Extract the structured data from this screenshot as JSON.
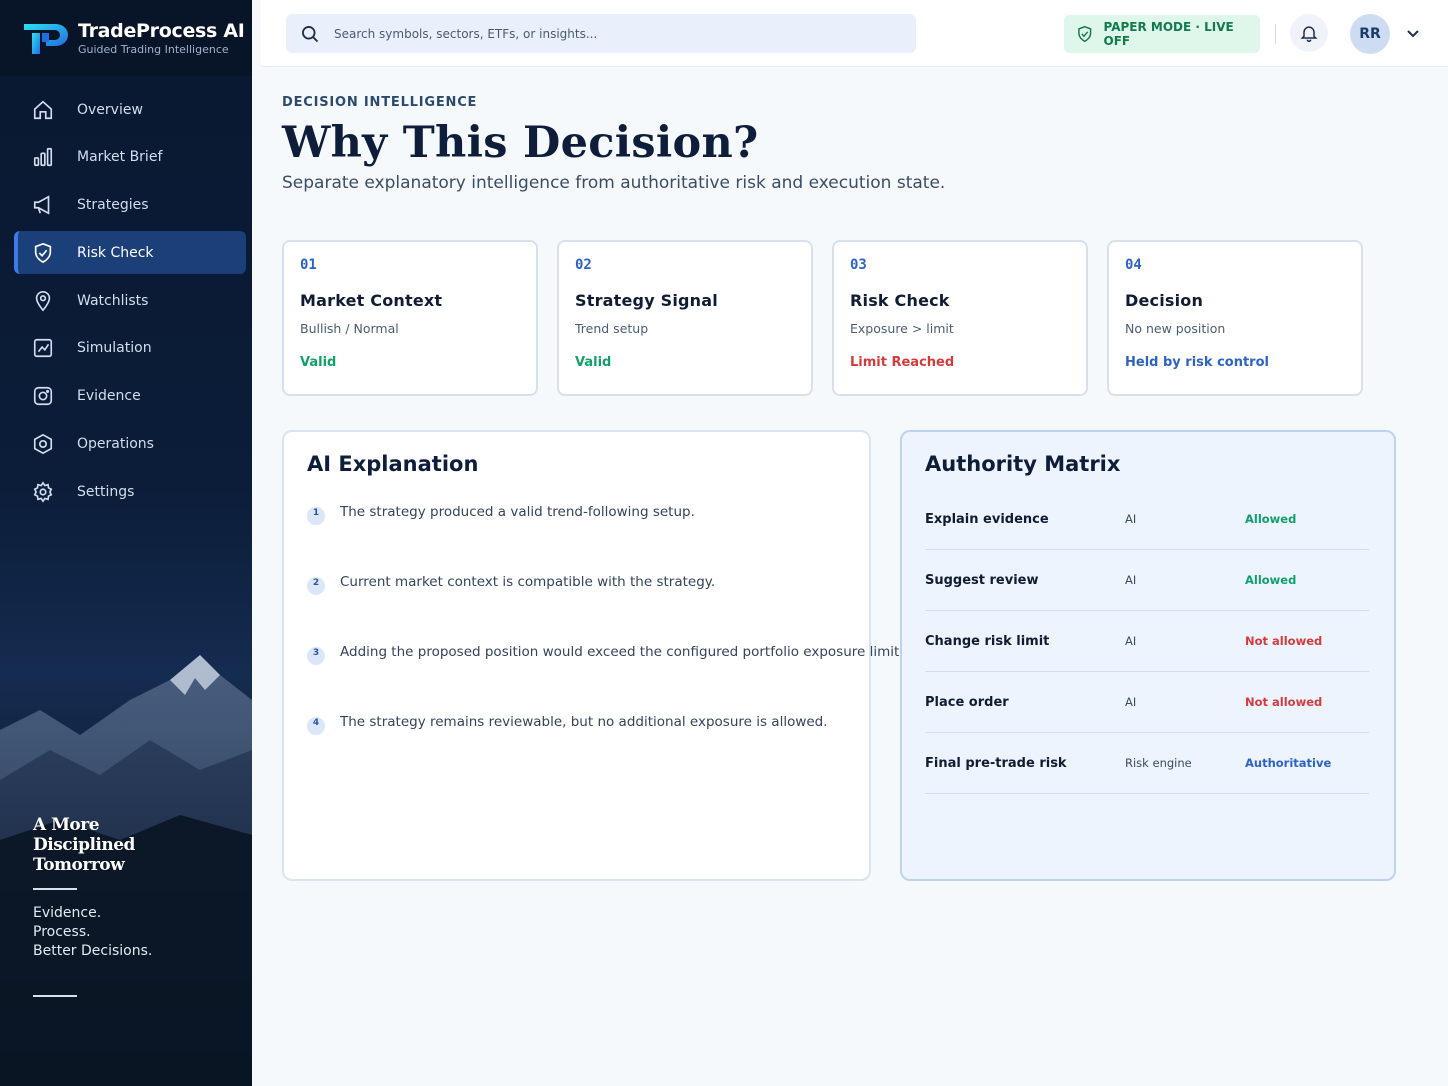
{
  "brand": {
    "name": "TradeProcess AI",
    "tagline": "Guided Trading Intelligence"
  },
  "sidebar": {
    "items": [
      {
        "label": "Overview",
        "icon": "home-icon"
      },
      {
        "label": "Market Brief",
        "icon": "bar-chart-icon"
      },
      {
        "label": "Strategies",
        "icon": "megaphone-icon"
      },
      {
        "label": "Risk Check",
        "icon": "shield-icon",
        "active": true
      },
      {
        "label": "Watchlists",
        "icon": "location-pin-icon"
      },
      {
        "label": "Simulation",
        "icon": "chart-square-icon"
      },
      {
        "label": "Evidence",
        "icon": "camera-icon"
      },
      {
        "label": "Operations",
        "icon": "hexagon-gear-icon"
      },
      {
        "label": "Settings",
        "icon": "gear-icon"
      }
    ],
    "promo": {
      "title_lines": [
        "A More",
        "Disciplined",
        "Tomorrow"
      ],
      "motto_lines": [
        "Evidence.",
        "Process.",
        "Better Decisions."
      ]
    }
  },
  "topbar": {
    "search_placeholder": "Search symbols, sectors, ETFs, or insights...",
    "mode_badge": "PAPER MODE · LIVE OFF",
    "avatar_initials": "RR"
  },
  "header": {
    "eyebrow": "DECISION INTELLIGENCE",
    "title": "Why This Decision?",
    "subtitle": "Separate explanatory intelligence from authoritative risk and execution state."
  },
  "steps": [
    {
      "num": "01",
      "title": "Market Context",
      "sub": "Bullish / Normal",
      "status": "Valid",
      "status_color": "#12a06a"
    },
    {
      "num": "02",
      "title": "Strategy Signal",
      "sub": "Trend setup",
      "status": "Valid",
      "status_color": "#12a06a"
    },
    {
      "num": "03",
      "title": "Risk Check",
      "sub": "Exposure > limit",
      "status": "Limit Reached",
      "status_color": "#d43c3c"
    },
    {
      "num": "04",
      "title": "Decision",
      "sub": "No new position",
      "status": "Held by risk control",
      "status_color": "#2d63c6"
    }
  ],
  "ai_explanation": {
    "title": "AI Explanation",
    "items": [
      {
        "n": "1",
        "text": "The strategy produced a valid trend-following setup."
      },
      {
        "n": "2",
        "text": "Current market context is compatible with the strategy."
      },
      {
        "n": "3",
        "text": "Adding the proposed position would exceed the configured portfolio exposure limit."
      },
      {
        "n": "4",
        "text": "The strategy remains reviewable, but no additional exposure is allowed."
      }
    ]
  },
  "authority_matrix": {
    "title": "Authority Matrix",
    "rows": [
      {
        "capability": "Explain evidence",
        "actor": "AI",
        "status": "Allowed",
        "color": "#12a06a"
      },
      {
        "capability": "Suggest review",
        "actor": "AI",
        "status": "Allowed",
        "color": "#12a06a"
      },
      {
        "capability": "Change risk limit",
        "actor": "AI",
        "status": "Not allowed",
        "color": "#d43c3c"
      },
      {
        "capability": "Place order",
        "actor": "AI",
        "status": "Not allowed",
        "color": "#d43c3c"
      },
      {
        "capability": "Final pre-trade risk",
        "actor": "Risk engine",
        "status": "Authoritative",
        "color": "#2d63c6"
      }
    ]
  }
}
